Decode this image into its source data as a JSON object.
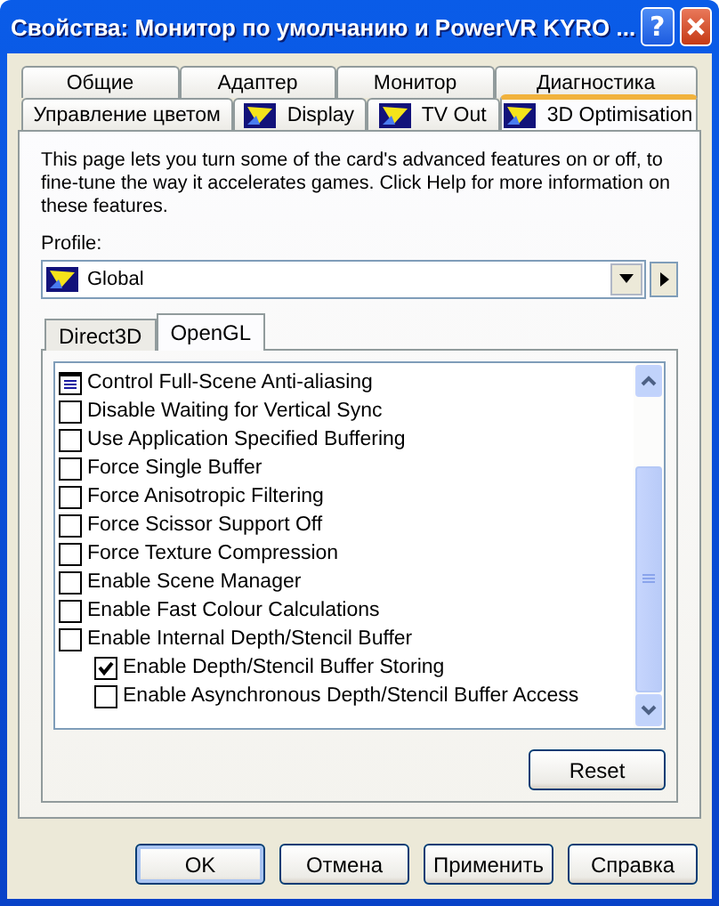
{
  "window": {
    "title": "Свойства: Монитор по умолчанию и PowerVR KYRO ...",
    "help_button": "?"
  },
  "tab_rows": [
    [
      {
        "label": "Общие",
        "icon": false,
        "selected": false
      },
      {
        "label": "Адаптер",
        "icon": false,
        "selected": false
      },
      {
        "label": "Монитор",
        "icon": false,
        "selected": false
      },
      {
        "label": "Диагностика",
        "icon": false,
        "selected": false
      }
    ],
    [
      {
        "label": "Управление цветом",
        "icon": false,
        "selected": false
      },
      {
        "label": "Display",
        "icon": true,
        "selected": false
      },
      {
        "label": "TV Out",
        "icon": true,
        "selected": false
      },
      {
        "label": "3D Optimisation",
        "icon": true,
        "selected": true
      }
    ]
  ],
  "description": "This page lets you turn some of the card's advanced features on or off, to fine-tune the way it accelerates games. Click Help for more information on these features.",
  "profile": {
    "label": "Profile:",
    "value": "Global"
  },
  "subtabs": [
    {
      "label": "Direct3D",
      "selected": false
    },
    {
      "label": "OpenGL",
      "selected": true
    }
  ],
  "options": [
    {
      "kind": "group",
      "label": "Control Full-Scene Anti-aliasing"
    },
    {
      "kind": "check",
      "label": "Disable Waiting for Vertical Sync",
      "checked": false
    },
    {
      "kind": "check",
      "label": "Use Application Specified Buffering",
      "checked": false
    },
    {
      "kind": "check",
      "label": "Force Single Buffer",
      "checked": false
    },
    {
      "kind": "check",
      "label": "Force Anisotropic Filtering",
      "checked": false
    },
    {
      "kind": "check",
      "label": "Force Scissor Support Off",
      "checked": false
    },
    {
      "kind": "check",
      "label": "Force Texture Compression",
      "checked": false
    },
    {
      "kind": "check",
      "label": "Enable Scene Manager",
      "checked": false
    },
    {
      "kind": "check",
      "label": "Enable Fast Colour Calculations",
      "checked": false
    },
    {
      "kind": "check",
      "label": "Enable Internal Depth/Stencil Buffer",
      "checked": false,
      "children": [
        {
          "kind": "check",
          "label": "Enable Depth/Stencil Buffer Storing",
          "checked": true
        },
        {
          "kind": "check",
          "label": "Enable Asynchronous Depth/Stencil Buffer Access",
          "checked": false
        }
      ]
    }
  ],
  "reset_button": "Reset",
  "buttons": [
    {
      "label": "OK",
      "default": true
    },
    {
      "label": "Отмена",
      "default": false
    },
    {
      "label": "Применить",
      "default": false
    },
    {
      "label": "Справка",
      "default": false
    }
  ]
}
